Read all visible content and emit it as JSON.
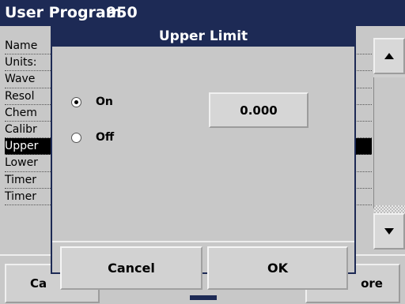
{
  "background": {
    "title": "User Program",
    "program_number": "950",
    "list_items": [
      {
        "label": "Name",
        "selected": false
      },
      {
        "label": "Units:",
        "selected": false
      },
      {
        "label": "Wave",
        "selected": false
      },
      {
        "label": "Resol",
        "selected": false
      },
      {
        "label": "Chem",
        "selected": false
      },
      {
        "label": "Calibr",
        "selected": false
      },
      {
        "label": "Upper",
        "selected": true
      },
      {
        "label": "Lower",
        "selected": false
      },
      {
        "label": "Timer",
        "selected": false
      },
      {
        "label": "Timer",
        "selected": false
      }
    ],
    "scroll_up_icon": "triangle-up-icon",
    "scroll_down_icon": "triangle-down-icon",
    "left_button": "Ca",
    "right_button": "ore"
  },
  "dialog": {
    "title": "Upper Limit",
    "options": [
      {
        "label": "On",
        "checked": true
      },
      {
        "label": "Off",
        "checked": false
      }
    ],
    "value": "0.000",
    "cancel_label": "Cancel",
    "ok_label": "OK"
  },
  "colors": {
    "title_bar": "#1d2a55",
    "panel": "#c8c8c8"
  }
}
